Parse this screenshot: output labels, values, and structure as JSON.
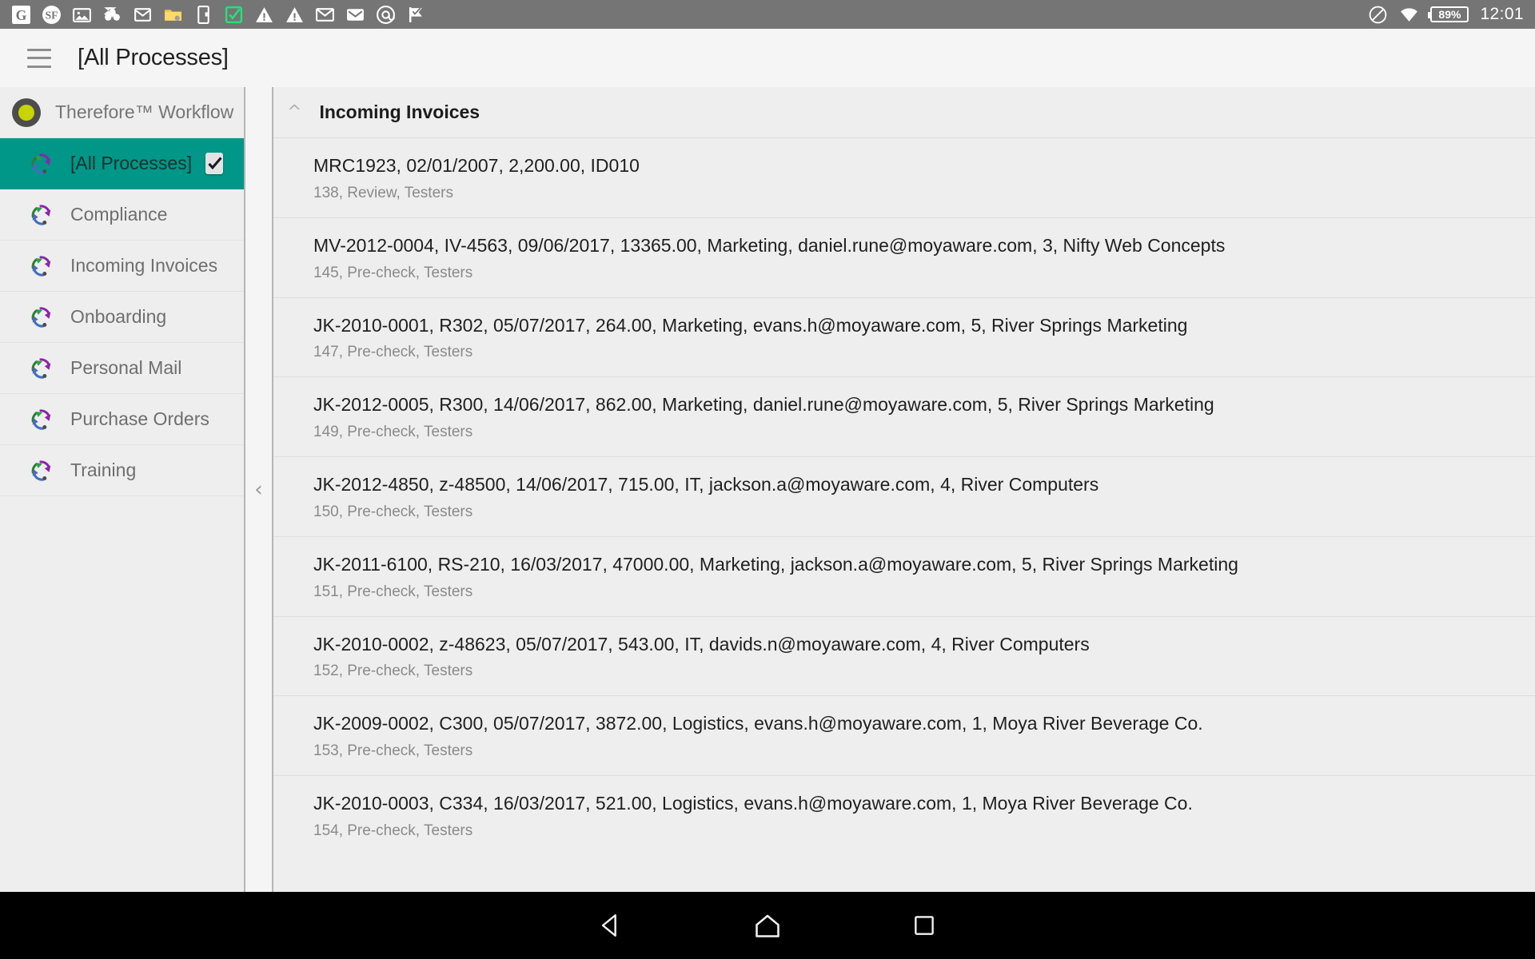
{
  "statusbar": {
    "left_icons": [
      "google-icon",
      "stumbleupon-icon",
      "photos-icon",
      "dropbox-icon",
      "gmail-icon",
      "folder-icon",
      "device-icon",
      "checkbox-green-icon",
      "warning-icon",
      "warning-icon",
      "mail-icon",
      "email-open-icon",
      "at-mention-icon",
      "flag-check-icon"
    ],
    "dnd_icon": "do-not-disturb-icon",
    "wifi_icon": "wifi-icon",
    "battery_icon": "battery-icon",
    "battery_level": "89%",
    "clock": "12:01"
  },
  "appbar": {
    "menu_icon": "hamburger-menu-icon",
    "title": "[All Processes]"
  },
  "sidebar": {
    "brand": {
      "logo_icon": "therefore-logo-icon",
      "label": "Therefore™ Workflow"
    },
    "items": [
      {
        "label": "[All Processes]",
        "icon": "workflow-icon",
        "active": true,
        "checked": true
      },
      {
        "label": "Compliance",
        "icon": "workflow-icon",
        "active": false,
        "checked": false
      },
      {
        "label": "Incoming Invoices",
        "icon": "workflow-icon",
        "active": false,
        "checked": false
      },
      {
        "label": "Onboarding",
        "icon": "workflow-icon",
        "active": false,
        "checked": false
      },
      {
        "label": "Personal Mail",
        "icon": "workflow-icon",
        "active": false,
        "checked": false
      },
      {
        "label": "Purchase Orders",
        "icon": "workflow-icon",
        "active": false,
        "checked": false
      },
      {
        "label": "Training",
        "icon": "workflow-icon",
        "active": false,
        "checked": false
      }
    ],
    "collapse_handle_icon": "chevron-left-icon"
  },
  "main": {
    "group": {
      "collapse_icon": "chevron-up-icon",
      "title": "Incoming Invoices"
    },
    "rows": [
      {
        "primary": "MRC1923, 02/01/2007, 2,200.00, ID010",
        "secondary": "138, Review, Testers"
      },
      {
        "primary": "MV-2012-0004, IV-4563, 09/06/2017, 13365.00, Marketing, daniel.rune@moyaware.com, 3, Nifty Web Concepts",
        "secondary": "145, Pre-check, Testers"
      },
      {
        "primary": "JK-2010-0001, R302, 05/07/2017, 264.00, Marketing, evans.h@moyaware.com, 5, River Springs Marketing",
        "secondary": "147, Pre-check, Testers"
      },
      {
        "primary": "JK-2012-0005, R300, 14/06/2017, 862.00, Marketing, daniel.rune@moyaware.com, 5, River Springs Marketing",
        "secondary": "149, Pre-check, Testers"
      },
      {
        "primary": "JK-2012-4850, z-48500, 14/06/2017, 715.00, IT, jackson.a@moyaware.com, 4, River Computers",
        "secondary": "150, Pre-check, Testers"
      },
      {
        "primary": "JK-2011-6100, RS-210, 16/03/2017, 47000.00, Marketing, jackson.a@moyaware.com, 5, River Springs Marketing",
        "secondary": "151, Pre-check, Testers"
      },
      {
        "primary": "JK-2010-0002, z-48623, 05/07/2017, 543.00, IT, davids.n@moyaware.com, 4, River Computers",
        "secondary": "152, Pre-check, Testers"
      },
      {
        "primary": "JK-2009-0002, C300, 05/07/2017, 3872.00, Logistics, evans.h@moyaware.com, 1, Moya River Beverage Co.",
        "secondary": "153, Pre-check, Testers"
      },
      {
        "primary": "JK-2010-0003, C334, 16/03/2017, 521.00, Logistics, evans.h@moyaware.com, 1, Moya River Beverage Co.",
        "secondary": "154, Pre-check, Testers"
      }
    ]
  },
  "navbar": {
    "back_icon": "back-triangle-icon",
    "home_icon": "home-circle-icon",
    "recents_icon": "recents-square-icon"
  },
  "colors": {
    "accent_teal": "#009688",
    "statusbar_gray": "#757575",
    "panel_gray": "#eeeeee",
    "page_gray": "#f5f5f5",
    "logo_green": "#c8d400"
  }
}
